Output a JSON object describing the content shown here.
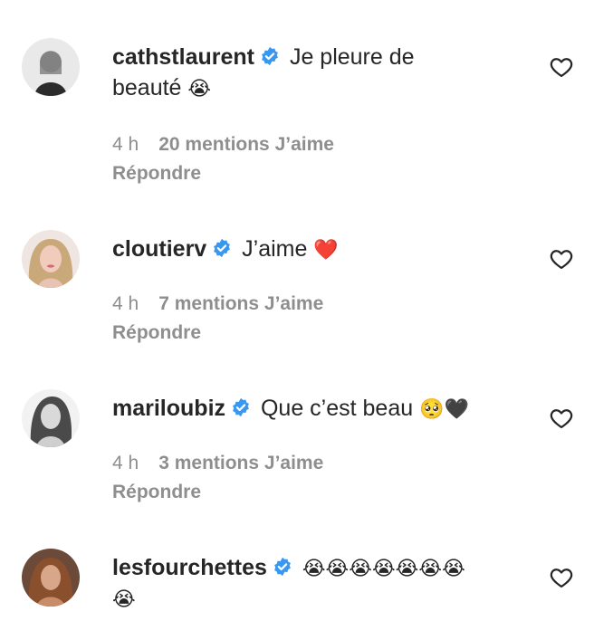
{
  "comments": [
    {
      "username": "cathstlaurent",
      "verified": true,
      "text_line1": "Je pleure de",
      "text_line2": "beauté",
      "emoji_line2": "😭",
      "time": "4 h",
      "likes": "20 mentions J’aime",
      "reply": "Répondre"
    },
    {
      "username": "cloutierv",
      "verified": true,
      "text": "J’aime",
      "emoji": "❤️",
      "time": "4 h",
      "likes": "7 mentions J’aime",
      "reply": "Répondre"
    },
    {
      "username": "mariloubiz",
      "verified": true,
      "text": "Que c’est beau",
      "emoji": "🥺🖤",
      "time": "4 h",
      "likes": "3 mentions J’aime",
      "reply": "Répondre"
    },
    {
      "username": "lesfourchettes",
      "verified": true,
      "emoji_line1": "😭😭😭😭😭😭😭",
      "emoji_line2": "😭"
    }
  ],
  "icons": {
    "verified": "verified-badge-icon",
    "like": "heart-outline-icon"
  },
  "colors": {
    "verified_blue": "#3897f0",
    "secondary_text": "#8e8e8e",
    "primary_text": "#262626"
  }
}
